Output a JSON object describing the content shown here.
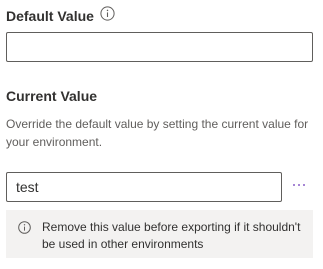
{
  "default_value": {
    "label": "Default Value",
    "value": "",
    "info_icon": "info-circle-icon"
  },
  "current_value": {
    "label": "Current Value",
    "description": "Override the default value by setting the current value for your environment.",
    "value": "test",
    "more_icon": "ellipsis-icon"
  },
  "notice": {
    "icon": "info-circle-icon",
    "text": "Remove this value before exporting if it shouldn't be used in other environments"
  },
  "colors": {
    "accent": "#8a5fc8",
    "notice_background": "#f3f2f1",
    "text": "#323130",
    "secondary_text": "#605e5c"
  }
}
